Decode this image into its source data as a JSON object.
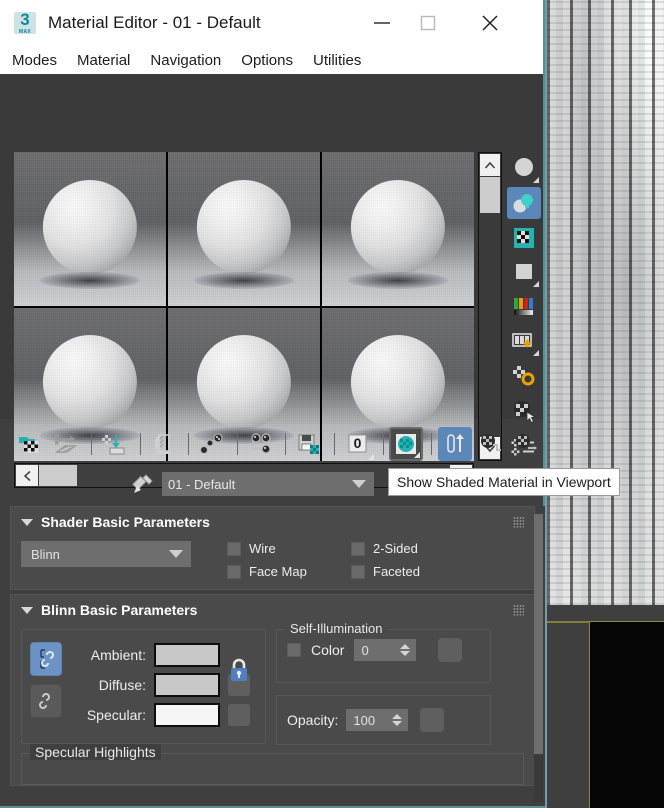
{
  "window": {
    "title": "Material Editor - 01 - Default",
    "app_icon": {
      "glyph": "3",
      "sub": "MAX"
    },
    "buttons": {
      "minimize": "minimize-button",
      "maximize": "maximize-button",
      "close": "close-button"
    }
  },
  "menubar": {
    "items": [
      {
        "label": "Modes"
      },
      {
        "label": "Material"
      },
      {
        "label": "Navigation"
      },
      {
        "label": "Options"
      },
      {
        "label": "Utilities"
      }
    ]
  },
  "slots": {
    "count": 6,
    "selected_index": 0,
    "items": [
      {
        "name": "slot-1"
      },
      {
        "name": "slot-2"
      },
      {
        "name": "slot-3"
      },
      {
        "name": "slot-4"
      },
      {
        "name": "slot-5"
      },
      {
        "name": "slot-6"
      }
    ]
  },
  "vertical_tools": [
    {
      "name": "sample-type-icon",
      "active": false,
      "flyout": true
    },
    {
      "name": "backlight-icon",
      "active": true,
      "flyout": false
    },
    {
      "name": "background-checker-icon",
      "active": false,
      "flyout": false
    },
    {
      "name": "sample-uv-tiling-icon",
      "active": false,
      "flyout": true
    },
    {
      "name": "video-color-check-icon",
      "active": false,
      "flyout": false
    },
    {
      "name": "make-preview-icon",
      "active": false,
      "flyout": true
    },
    {
      "name": "options-gear-icon",
      "active": false,
      "flyout": false
    },
    {
      "name": "select-by-material-icon",
      "active": false,
      "flyout": false
    },
    {
      "name": "material-id-channel-icon",
      "active": false,
      "flyout": false
    }
  ],
  "horizontal_tools": [
    {
      "name": "get-material-icon"
    },
    {
      "name": "put-material-to-scene-icon"
    },
    {
      "separator_after": true
    },
    {
      "name": "assign-material-to-selection-icon"
    },
    {
      "separator_after": true
    },
    {
      "name": "reset-map-material-icon"
    },
    {
      "separator_after": true
    },
    {
      "name": "make-material-copy-icon"
    },
    {
      "separator_after": true
    },
    {
      "name": "make-unique-icon"
    },
    {
      "separator_after": true
    },
    {
      "name": "put-to-library-icon"
    },
    {
      "separator_after": true
    },
    {
      "name": "material-effects-channel-icon",
      "label": "0",
      "flyout": true
    },
    {
      "separator_after": true
    },
    {
      "name": "show-shaded-material-in-viewport-icon",
      "framed": true,
      "flyout": true
    },
    {
      "separator_after": true
    },
    {
      "name": "show-end-result-icon",
      "active": true
    },
    {
      "name": "go-to-parent-icon"
    },
    {
      "name": "go-forward-to-sibling-icon"
    }
  ],
  "tooltip": {
    "text": "Show Shaded Material in Viewport"
  },
  "material_name": {
    "eyedropper": "pick-material-from-object-icon",
    "value": "01 - Default"
  },
  "shader_rollout": {
    "title": "Shader Basic Parameters",
    "shader": {
      "value": "Blinn"
    },
    "checkboxes": [
      {
        "label": "Wire",
        "checked": false
      },
      {
        "label": "2-Sided",
        "checked": false
      },
      {
        "label": "Face Map",
        "checked": false
      },
      {
        "label": "Faceted",
        "checked": false
      }
    ]
  },
  "blinn_rollout": {
    "title": "Blinn Basic Parameters",
    "colors": [
      {
        "label": "Ambient:",
        "swatch": "#c8c8c8"
      },
      {
        "label": "Diffuse:",
        "swatch": "#c8c8c8"
      },
      {
        "label": "Specular:",
        "swatch": "#f6f6f6"
      }
    ],
    "locks": {
      "ambient_diffuse": {
        "name": "lock-ambient-diffuse-icon",
        "on": true
      },
      "diffuse_specular": {
        "name": "lock-diffuse-specular-icon",
        "on": false
      },
      "big_lock": {
        "name": "lock-icon",
        "on": true
      }
    },
    "self_illumination": {
      "title": "Self-Illumination",
      "color_label": "Color",
      "color_checked": false,
      "value": "0"
    },
    "opacity": {
      "label": "Opacity:",
      "value": "100"
    }
  },
  "specular_highlights": {
    "title": "Specular Highlights"
  },
  "scrollbars": {
    "slot_vertical": {
      "up": "scroll-up-arrow-icon",
      "down": "scroll-down-arrow-icon"
    },
    "slot_horizontal": {
      "left": "scroll-left-arrow-icon",
      "right": "scroll-right-arrow-icon"
    }
  },
  "theme": {
    "window_bg": "#3f3f3f",
    "panel_bg": "#4a4a4a",
    "accent_blue": "#5b87b9",
    "accent_teal": "#0a8a9a",
    "border_teal": "#5a8d96",
    "text": "#ededed"
  }
}
